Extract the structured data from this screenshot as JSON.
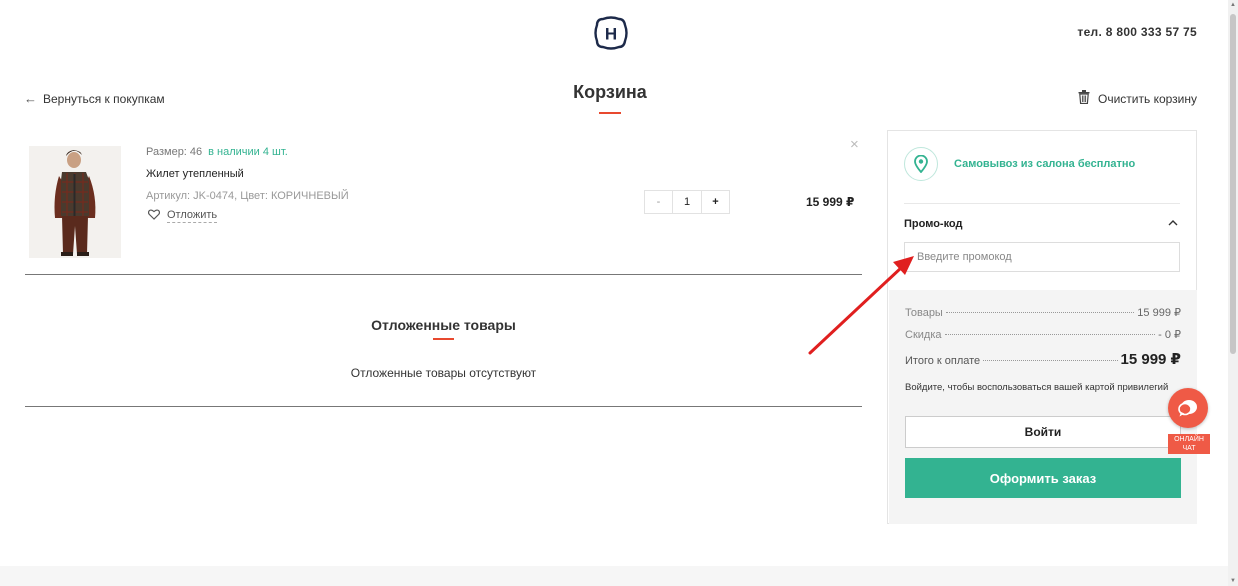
{
  "header": {
    "logo_letter": "H",
    "phone": "тел. 8 800 333 57 75"
  },
  "nav": {
    "back_label": "Вернуться к покупкам",
    "page_title": "Корзина",
    "clear_label": "Очистить корзину"
  },
  "cart": {
    "item": {
      "size_text": "Размер: 46",
      "stock_text": "в наличии 4 шт.",
      "name": "Жилет утепленный",
      "article_text": "Артикул: JK-0474, Цвет: КОРИЧНЕВЫЙ",
      "postpone_label": "Отложить",
      "qty_minus": "-",
      "qty_value": "1",
      "qty_plus": "+",
      "price": "15 999 ₽",
      "remove_symbol": "×"
    }
  },
  "postponed": {
    "title": "Отложенные товары",
    "empty_text": "Отложенные товары отсутствуют"
  },
  "sidebar": {
    "pickup_text": "Самовывоз из салона бесплатно",
    "promo_label": "Промо-код",
    "promo_placeholder": "Введите промокод",
    "summary": {
      "goods_label": "Товары",
      "goods_value": "15 999 ₽",
      "discount_label": "Скидка",
      "discount_value": "- 0 ₽",
      "total_label": "Итого к оплате",
      "total_value": "15 999 ₽"
    },
    "login_hint": "Войдите, чтобы воспользоваться вашей картой привилегий",
    "login_button": "Войти",
    "order_button": "Оформить заказ"
  },
  "chat": {
    "label_line1": "ОНЛАЙН",
    "label_line2": "ЧАТ"
  },
  "colors": {
    "accent_green": "#33b391",
    "accent_red": "#e8492f",
    "chat_red": "#ef5a46",
    "brand_navy": "#1d2a4a"
  }
}
